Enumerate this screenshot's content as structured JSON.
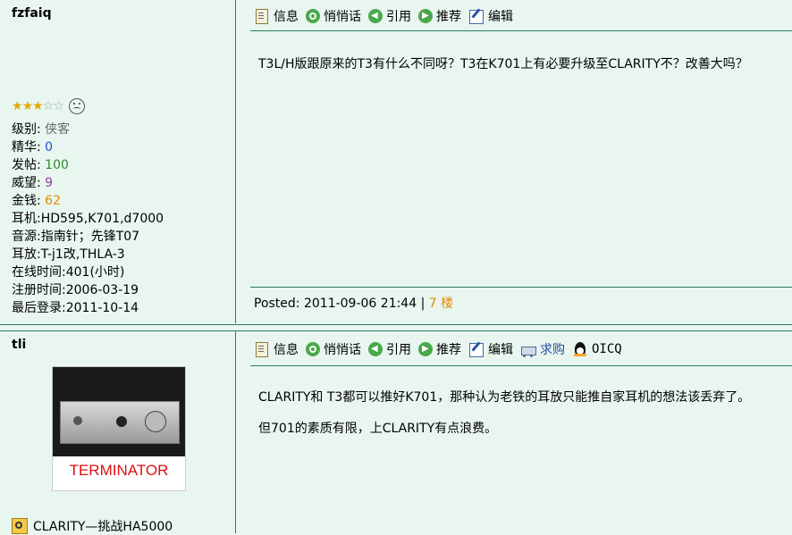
{
  "post1": {
    "username": "fzfaiq",
    "toolbar": [
      "信息",
      "悄悄话",
      "引用",
      "推荐",
      "编辑"
    ],
    "content": "T3L/H版跟原来的T3有什么不同呀？T3在K701上有必要升级至CLARITY不？改善大吗？",
    "info": [
      {
        "label": "级别:",
        "value": "侠客",
        "color": "#6b6b6b"
      },
      {
        "label": "精华:",
        "value": "0",
        "color": "#1f4fcf"
      },
      {
        "label": "发帖:",
        "value": "100",
        "color": "#2d8a2d"
      },
      {
        "label": "威望:",
        "value": "9",
        "color": "#8b3fa0"
      },
      {
        "label": "金钱:",
        "value": "62",
        "color": "#e68a00"
      }
    ],
    "extra": [
      "耳机:HD595,K701,d7000",
      "音源:指南针；先锋T07",
      "耳放:T-j1改,THLA-3",
      "在线时间:401(小时)",
      "注册时间:2006-03-19",
      "最后登录:2011-10-14"
    ],
    "stars_filled": 3,
    "stars_total": 5,
    "posted_label": "Posted:",
    "posted_time": "2011-09-06 21:44",
    "floor": "7 楼"
  },
  "post2": {
    "username": "tli",
    "toolbar": [
      "信息",
      "悄悄话",
      "引用",
      "推荐",
      "编辑",
      "求购",
      "OICQ"
    ],
    "content_lines": [
      "CLARITY和  T3都可以推好K701，那种认为老铁的耳放只能推自家耳机的想法该丢弃了。",
      "但701的素质有限，上CLARITY有点浪费。"
    ],
    "avatar_text": "TERMINATOR",
    "signature": "CLARITY—挑战HA5000"
  },
  "colors": {
    "bg": "#e8f6ef",
    "line": "#2f7a5e",
    "floor": "#e68a00"
  }
}
